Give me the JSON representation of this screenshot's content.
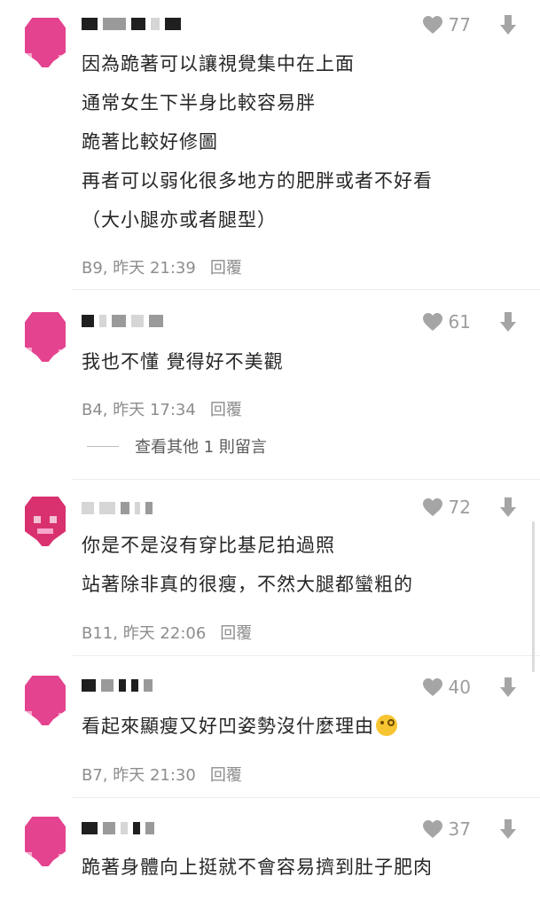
{
  "comments": [
    {
      "likes": "77",
      "lines": [
        "因為跪著可以讓視覺集中在上面",
        "通常女生下半身比較容易胖",
        "跪著比較好修圖",
        "再者可以弱化很多地方的肥胖或者不好看",
        "（大小腿亦或者腿型）"
      ],
      "meta": "B9, 昨天 21:39",
      "reply": "回覆"
    },
    {
      "likes": "61",
      "lines": [
        "我也不懂 覺得好不美觀"
      ],
      "meta": "B4, 昨天 17:34",
      "reply": "回覆",
      "more": "查看其他 1 則留言"
    },
    {
      "likes": "72",
      "lines": [
        "你是不是沒有穿比基尼拍過照",
        "站著除非真的很瘦，不然大腿都蠻粗的"
      ],
      "meta": "B11, 昨天 22:06",
      "reply": "回覆"
    },
    {
      "likes": "40",
      "lines": [
        "看起來顯瘦又好凹姿勢沒什麼理由"
      ],
      "emoji": "face-with-monocle",
      "meta": "B7, 昨天 21:30",
      "reply": "回覆"
    },
    {
      "likes": "37",
      "lines": [
        "跪著身體向上挺就不會容易擠到肚子肥肉"
      ]
    }
  ],
  "icons": {
    "like": "heart-icon",
    "dislike": "down-arrow-icon"
  },
  "colors": {
    "avatar": "#e4438f",
    "text": "#262626",
    "muted": "#8d8d8d",
    "icon": "#a5a5a5"
  }
}
